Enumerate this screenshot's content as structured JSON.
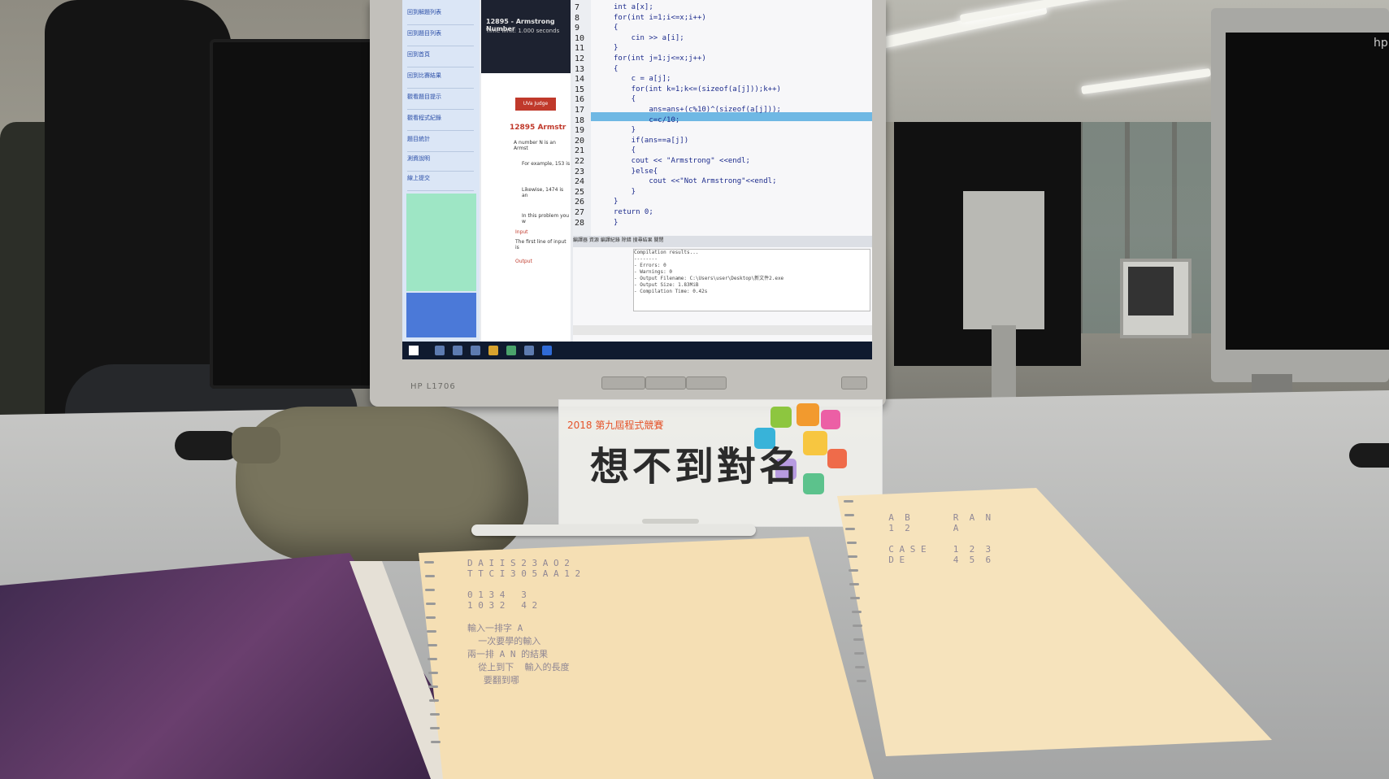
{
  "scene": {
    "description_labels": {
      "monitor_brand": "HP L1706",
      "right_monitor_logo": "hp"
    }
  },
  "screen": {
    "problem": {
      "title": "12895 - Armstrong Number",
      "time_limit": "Time limit: 1.000 seconds",
      "heading": "12895  Armstr",
      "logo": "UVa Judge",
      "lines": [
        "A number N is an Armst",
        "For example, 153 is",
        "Likewise, 1474 is an",
        "In this problem you w",
        "Input",
        "The first line of input is",
        "Output"
      ]
    },
    "sidebar_items": [
      "回到解題列表",
      "回到題目列表",
      "回到首頁",
      "回到比賽結果",
      "觀看題目提示",
      "觀看程式紀錄",
      "題目統計",
      "測資說明",
      "線上提交"
    ],
    "code_lines": [
      {
        "n": "7",
        "text": "int a[x];"
      },
      {
        "n": "8",
        "text": "for(int i=1;i<=x;i++)"
      },
      {
        "n": "9",
        "text": "{"
      },
      {
        "n": "10",
        "text": "    cin >> a[i];"
      },
      {
        "n": "11",
        "text": "}"
      },
      {
        "n": "12",
        "text": "for(int j=1;j<=x;j++)"
      },
      {
        "n": "13",
        "text": "{"
      },
      {
        "n": "14",
        "text": "    c = a[j];"
      },
      {
        "n": "15",
        "text": "    for(int k=1;k<=(sizeof(a[j]));k++)"
      },
      {
        "n": "16",
        "text": "    {"
      },
      {
        "n": "17",
        "text": "        ans=ans+(c%10)^(sizeof(a[j]));"
      },
      {
        "n": "18",
        "text": "        c=c/10;"
      },
      {
        "n": "19",
        "text": "    }"
      },
      {
        "n": "20",
        "text": "    if(ans==a[j])"
      },
      {
        "n": "21",
        "text": "    {"
      },
      {
        "n": "22",
        "text": "    cout << \"Armstrong\" <<endl;"
      },
      {
        "n": "23",
        "text": "    }else{"
      },
      {
        "n": "24",
        "text": "        cout <<\"Not Armstrong\"<<endl;"
      },
      {
        "n": "25",
        "text": "    }"
      },
      {
        "n": "26",
        "text": "}"
      },
      {
        "n": "27",
        "text": "return 0;"
      },
      {
        "n": "28",
        "text": "}"
      }
    ],
    "compile_tabs": "編譯器 資源 編譯紀錄 除錯 搜尋結果 關閉",
    "compile_log": "Compilation results...\n--------\n- Errors: 0\n- Warnings: 0\n- Output Filename: C:\\Users\\user\\Desktop\\新文件2.exe\n- Output Size: 1.83MiB\n- Compilation Time: 0.42s"
  },
  "card": {
    "heading": "2018 第九屆程式競賽",
    "team_name": "想不到對名"
  },
  "notes": {
    "pad1": "D A I I S 2 3 A O 2\nT T C I 3 0 5 A A 1 2\n\n0 1 3 4   3\n1 0 3 2   4 2\n\n輸入一排字 A\n  一次要學的輸入\n兩一排 A N 的結果\n  從上到下  輸入的長度\n   要翻到哪",
    "pad2": "  A  B        R  A  N\n  1  2        A\n\n  C A S E     1  2  3\n  D E         4  5  6"
  }
}
